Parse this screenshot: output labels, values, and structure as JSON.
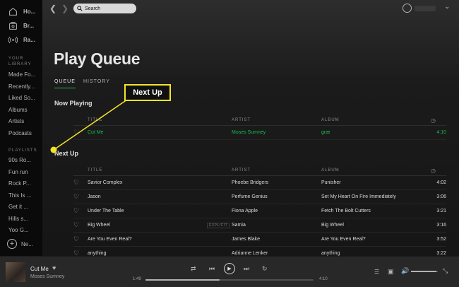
{
  "sidebar": {
    "nav": [
      {
        "label": "Ho...",
        "icon": "home-icon"
      },
      {
        "label": "Br...",
        "icon": "browse-icon"
      },
      {
        "label": "Ra...",
        "icon": "radio-icon"
      }
    ],
    "library_label": "YOUR LIBRARY",
    "library": [
      "Made Fo...",
      "Recently...",
      "Liked So...",
      "Albums",
      "Artists",
      "Podcasts"
    ],
    "playlists_label": "PLAYLISTS",
    "playlists": [
      "90s Ro...",
      "Fun run",
      "Rock P...",
      "This Is ...",
      "Get it ...",
      "Hills s...",
      "Yoo G..."
    ],
    "new_playlist": "Ne..."
  },
  "topbar": {
    "search_placeholder": "Search"
  },
  "page": {
    "title": "Play Queue",
    "tabs": [
      "QUEUE",
      "HISTORY"
    ],
    "active_tab": "QUEUE"
  },
  "columns": {
    "title": "TITLE",
    "artist": "ARTIST",
    "album": "ALBUM"
  },
  "now_playing": {
    "heading": "Now Playing",
    "track": {
      "title": "Cut Me",
      "artist": "Moses Sumney",
      "album": "græ",
      "duration": "4:10"
    }
  },
  "next_up": {
    "heading": "Next Up",
    "tracks": [
      {
        "title": "Savior Complex",
        "artist": "Phoebe Bridgers",
        "album": "Punisher",
        "duration": "4:02",
        "explicit": ""
      },
      {
        "title": "Jason",
        "artist": "Perfume Genius",
        "album": "Set My Heart On Fire Immediately",
        "duration": "3:06",
        "explicit": ""
      },
      {
        "title": "Under The Table",
        "artist": "Fiona Apple",
        "album": "Fetch The Bolt Cutters",
        "duration": "3:21",
        "explicit": ""
      },
      {
        "title": "Big Wheel",
        "artist": "Samia",
        "album": "Big Wheel",
        "duration": "3:16",
        "explicit": "EXPLICIT"
      },
      {
        "title": "Are You Even Real?",
        "artist": "James Blake",
        "album": "Are You Even Real?",
        "duration": "3:52",
        "explicit": ""
      },
      {
        "title": "anything",
        "artist": "Adrianne Lenker",
        "album": "anything",
        "duration": "3:22",
        "explicit": ""
      }
    ]
  },
  "callout": {
    "label": "Next Up",
    "color": "#f3e428"
  },
  "player": {
    "title": "Cut Me",
    "artist": "Moses Sumney",
    "elapsed": "1:49",
    "total": "4:10",
    "progress": 0.44,
    "volume": 0.95
  },
  "colors": {
    "accent": "#1db954",
    "background": "#121212"
  }
}
